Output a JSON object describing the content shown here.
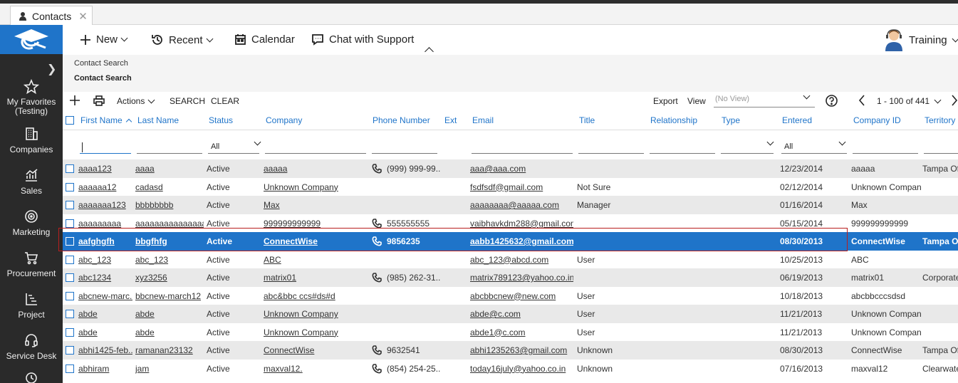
{
  "tab": {
    "label": "Contacts",
    "close": "✕"
  },
  "toolbar": {
    "new_label": "New",
    "recent_label": "Recent",
    "calendar_label": "Calendar",
    "chat_label": "Chat with Support",
    "user_label": "Training"
  },
  "nav": {
    "favorites_line1": "My Favorites",
    "favorites_line2": "(Testing)",
    "companies": "Companies",
    "sales": "Sales",
    "marketing": "Marketing",
    "procurement": "Procurement",
    "project": "Project",
    "service_desk": "Service Desk"
  },
  "breadcrumb": {
    "parent": "Contact Search",
    "current": "Contact Search"
  },
  "gridbar": {
    "actions": "Actions",
    "search": "SEARCH",
    "clear": "CLEAR",
    "export": "Export",
    "view": "View",
    "view_placeholder": "(No View)",
    "pagination": "1 - 100 of 441"
  },
  "columns": {
    "first_name": "First Name",
    "last_name": "Last Name",
    "status": "Status",
    "company": "Company",
    "phone": "Phone Number",
    "ext": "Ext",
    "email": "Email",
    "title": "Title",
    "relationship": "Relationship",
    "type": "Type",
    "entered": "Entered",
    "company_id": "Company ID",
    "territory": "Territory"
  },
  "filters": {
    "status": "All",
    "entered": "All"
  },
  "rows": [
    {
      "first": "aaaa123",
      "last": "aaaa",
      "status": "Active",
      "company": "aaaaa",
      "phone": "(999) 999-99...",
      "email": "aaa@aaa.com",
      "title": "",
      "entered": "12/23/2014",
      "company_id": "aaaaa",
      "territory": "Tampa Off"
    },
    {
      "first": "aaaaaa12",
      "last": "cadasd",
      "status": "Active",
      "company": "Unknown Company",
      "phone": "",
      "email": "fsdfsdf@gmail.com",
      "title": "Not Sure",
      "entered": "02/12/2014",
      "company_id": "Unknown Company",
      "territory": ""
    },
    {
      "first": "aaaaaaa123",
      "last": "bbbbbbbb",
      "status": "Active",
      "company": "Max",
      "phone": "",
      "email": "aaaaaaaa@aaaaa.com",
      "title": "Manager",
      "entered": "01/16/2014",
      "company_id": "Max",
      "territory": ""
    },
    {
      "first": "aaaaaaaaa",
      "last": "aaaaaaaaaaaaaaaa",
      "status": "Active",
      "company": "999999999999",
      "phone": "555555555",
      "email": "vaibhavkdm288@gmail.com",
      "title": "",
      "entered": "05/15/2014",
      "company_id": "999999999999",
      "territory": ""
    },
    {
      "first": "aafghgfh",
      "last": "bbgfhfg",
      "status": "Active",
      "company": "ConnectWise",
      "phone": "9856235",
      "email": "aabb1425632@gmail.com",
      "title": "",
      "entered": "08/30/2013",
      "company_id": "ConnectWise",
      "territory": "Tampa Off"
    },
    {
      "first": "abc_123",
      "last": "abc_123",
      "status": "Active",
      "company": "ABC",
      "phone": "",
      "email": "abc_123@abcd.com",
      "title": "User",
      "entered": "10/25/2013",
      "company_id": "ABC",
      "territory": ""
    },
    {
      "first": "abc1234",
      "last": "xyz3256",
      "status": "Active",
      "company": "matrix01",
      "phone": "(985) 262-31...",
      "email": "matrix789123@yahoo.co.in",
      "title": "",
      "entered": "06/19/2013",
      "company_id": "matrix01",
      "territory": "Corporate"
    },
    {
      "first": "abcnew-marc...",
      "last": "bbcnew-march12",
      "status": "Active",
      "company": "abc&bbc ccs#ds#d",
      "phone": "",
      "email": "abcbbcnew@new.com",
      "title": "User",
      "entered": "10/18/2013",
      "company_id": "abcbbcccsdsd",
      "territory": ""
    },
    {
      "first": "abde",
      "last": "abde",
      "status": "Active",
      "company": "Unknown Company",
      "phone": "",
      "email": "abde@c.com",
      "title": "User",
      "entered": "11/21/2013",
      "company_id": "Unknown Company",
      "territory": ""
    },
    {
      "first": "abde",
      "last": "abde",
      "status": "Active",
      "company": "Unknown Company",
      "phone": "",
      "email": "abde1@c.com",
      "title": "User",
      "entered": "11/21/2013",
      "company_id": "Unknown Company",
      "territory": ""
    },
    {
      "first": "abhi1425-feb...",
      "last": "ramanan23132",
      "status": "Active",
      "company": "ConnectWise",
      "phone": "9632541",
      "email": "abhi1235263@gmail.com",
      "title": "Unknown",
      "entered": "08/30/2013",
      "company_id": "ConnectWise",
      "territory": "Tampa Off"
    },
    {
      "first": "abhiram",
      "last": "jam",
      "status": "Active",
      "company": "maxval12.",
      "phone": "(854) 254-25...",
      "email": "today16july@yahoo.co.in",
      "title": "Unknown",
      "entered": "07/16/2013",
      "company_id": "maxval12",
      "territory": "Clearwate"
    }
  ],
  "selected_row_index": 4
}
